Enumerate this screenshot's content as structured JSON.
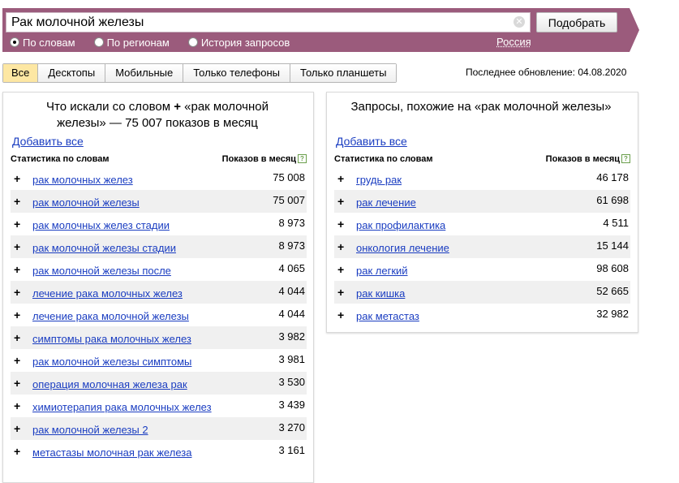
{
  "search": {
    "query": "Рак молочной железы",
    "submit_label": "Подобрать",
    "clear_glyph": "✕"
  },
  "modes": [
    {
      "label": "По словам",
      "selected": true
    },
    {
      "label": "По регионам",
      "selected": false
    },
    {
      "label": "История запросов",
      "selected": false
    }
  ],
  "region": "Россия",
  "device_tabs": [
    "Все",
    "Десктопы",
    "Мобильные",
    "Только телефоны",
    "Только планшеты"
  ],
  "last_update": "Последнее обновление: 04.08.2020",
  "left_panel": {
    "title_line1": "Что искали со словом",
    "title_plus": "+",
    "title_line1_end": "«рак молочной",
    "title_line2": "железы» — 75 007 показов в месяц",
    "add_all": "Добавить все",
    "col_stats": "Статистика по словам",
    "col_count": "Показов в месяц",
    "help_glyph": "?",
    "rows": [
      {
        "phrase": "рак молочных желез",
        "count": "75 008"
      },
      {
        "phrase": "рак молочной железы",
        "count": "75 007"
      },
      {
        "phrase": "рак молочных желез стадии",
        "count": "8 973"
      },
      {
        "phrase": "рак молочной железы стадии",
        "count": "8 973"
      },
      {
        "phrase": "рак молочной железы после",
        "count": "4 065"
      },
      {
        "phrase": "лечение рака молочных желез",
        "count": "4 044"
      },
      {
        "phrase": "лечение рака молочной железы",
        "count": "4 044"
      },
      {
        "phrase": "симптомы рака молочных желез",
        "count": "3 982"
      },
      {
        "phrase": "рак молочной железы симптомы",
        "count": "3 981"
      },
      {
        "phrase": "операция молочная железа рак",
        "count": "3 530"
      },
      {
        "phrase": "химиотерапия рака молочных желез",
        "count": "3 439"
      },
      {
        "phrase": "рак молочной железы 2",
        "count": "3 270"
      },
      {
        "phrase": "метастазы молочная рак железа",
        "count": "3 161"
      }
    ]
  },
  "right_panel": {
    "title": "Запросы, похожие на «рак молочной железы»",
    "add_all": "Добавить все",
    "col_stats": "Статистика по словам",
    "col_count": "Показов в месяц",
    "help_glyph": "?",
    "rows": [
      {
        "phrase": "грудь рак",
        "count": "46 178"
      },
      {
        "phrase": "рак лечение",
        "count": "61 698"
      },
      {
        "phrase": "рак профилактика",
        "count": "4 511"
      },
      {
        "phrase": "онкология лечение",
        "count": "15 144"
      },
      {
        "phrase": "рак легкий",
        "count": "98 608"
      },
      {
        "phrase": "рак кишка",
        "count": "52 665"
      },
      {
        "phrase": "рак метастаз",
        "count": "32 982"
      }
    ]
  },
  "row_plus_glyph": "+",
  "colors": {
    "topbar": "#9b5b7c",
    "active_tab": "#fde7a3",
    "link": "#1a3dc1",
    "alt_row": "#f0f0f0"
  }
}
